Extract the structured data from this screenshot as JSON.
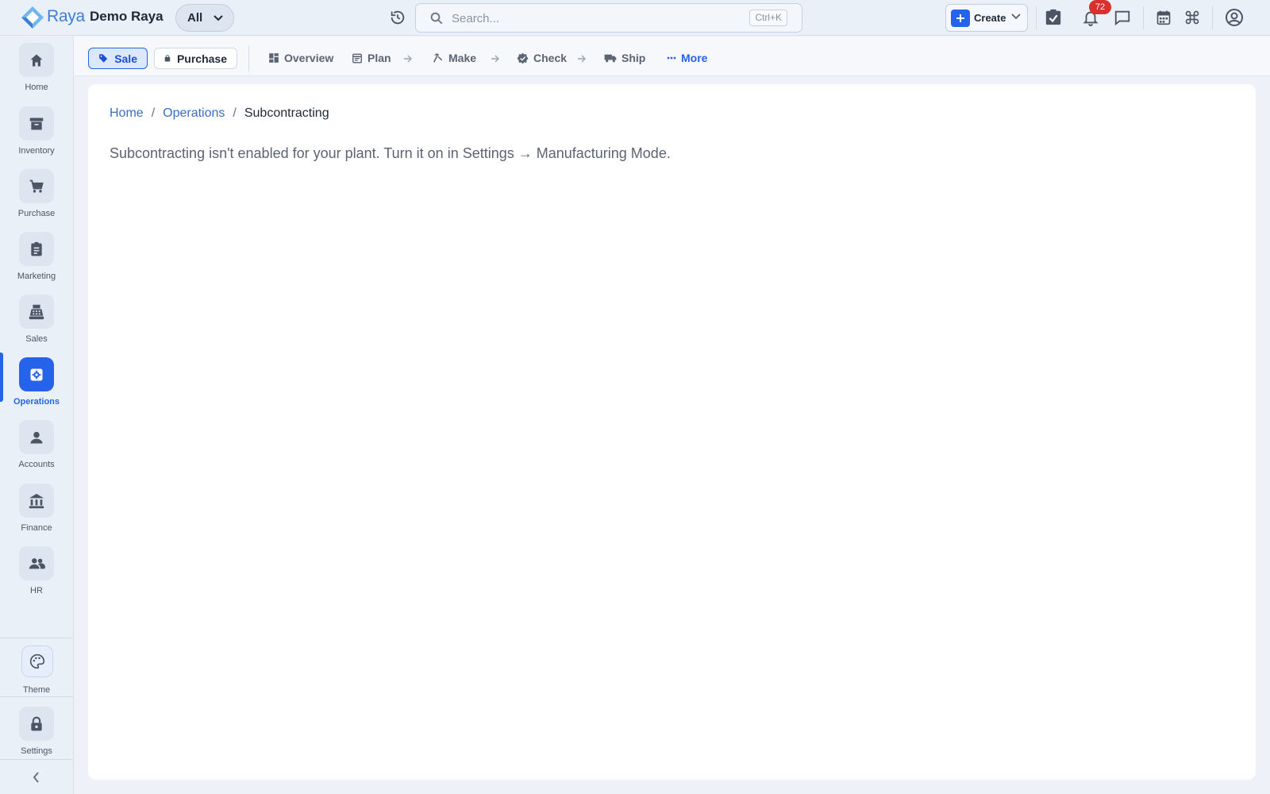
{
  "brand": {
    "logo_text": "Raya",
    "company": "Demo Raya"
  },
  "topbar": {
    "scope_label": "All",
    "search_placeholder": "Search...",
    "search_shortcut": "Ctrl+K",
    "create_label": "Create",
    "notification_count": "72",
    "icons": [
      "history-icon",
      "tasks-icon",
      "bell-icon",
      "chat-icon",
      "calendar-icon",
      "command-icon",
      "user-icon"
    ]
  },
  "sidebar": {
    "items": [
      {
        "label": "Home",
        "icon": "home-icon"
      },
      {
        "label": "Inventory",
        "icon": "archive-icon"
      },
      {
        "label": "Purchase",
        "icon": "cart-icon"
      },
      {
        "label": "Marketing",
        "icon": "clipboard-icon"
      },
      {
        "label": "Sales",
        "icon": "register-icon"
      },
      {
        "label": "Operations",
        "icon": "gear-icon",
        "active": true
      },
      {
        "label": "Accounts",
        "icon": "person-icon"
      },
      {
        "label": "Finance",
        "icon": "bank-icon"
      },
      {
        "label": "HR",
        "icon": "people-icon"
      }
    ],
    "theme_label": "Theme",
    "settings_label": "Settings"
  },
  "subnav": {
    "sale_label": "Sale",
    "purchase_label": "Purchase",
    "steps": [
      "Overview",
      "Plan",
      "Make",
      "Check",
      "Ship"
    ],
    "more_label": "More"
  },
  "breadcrumb": {
    "home": "Home",
    "section": "Operations",
    "current": "Subcontracting"
  },
  "main": {
    "message": "Subcontracting isn't enabled for your plant. Turn it on in Settings → Manufacturing Mode."
  },
  "colors": {
    "accent": "#2563eb",
    "badge": "#d9302c",
    "link": "#3b6fc0"
  }
}
